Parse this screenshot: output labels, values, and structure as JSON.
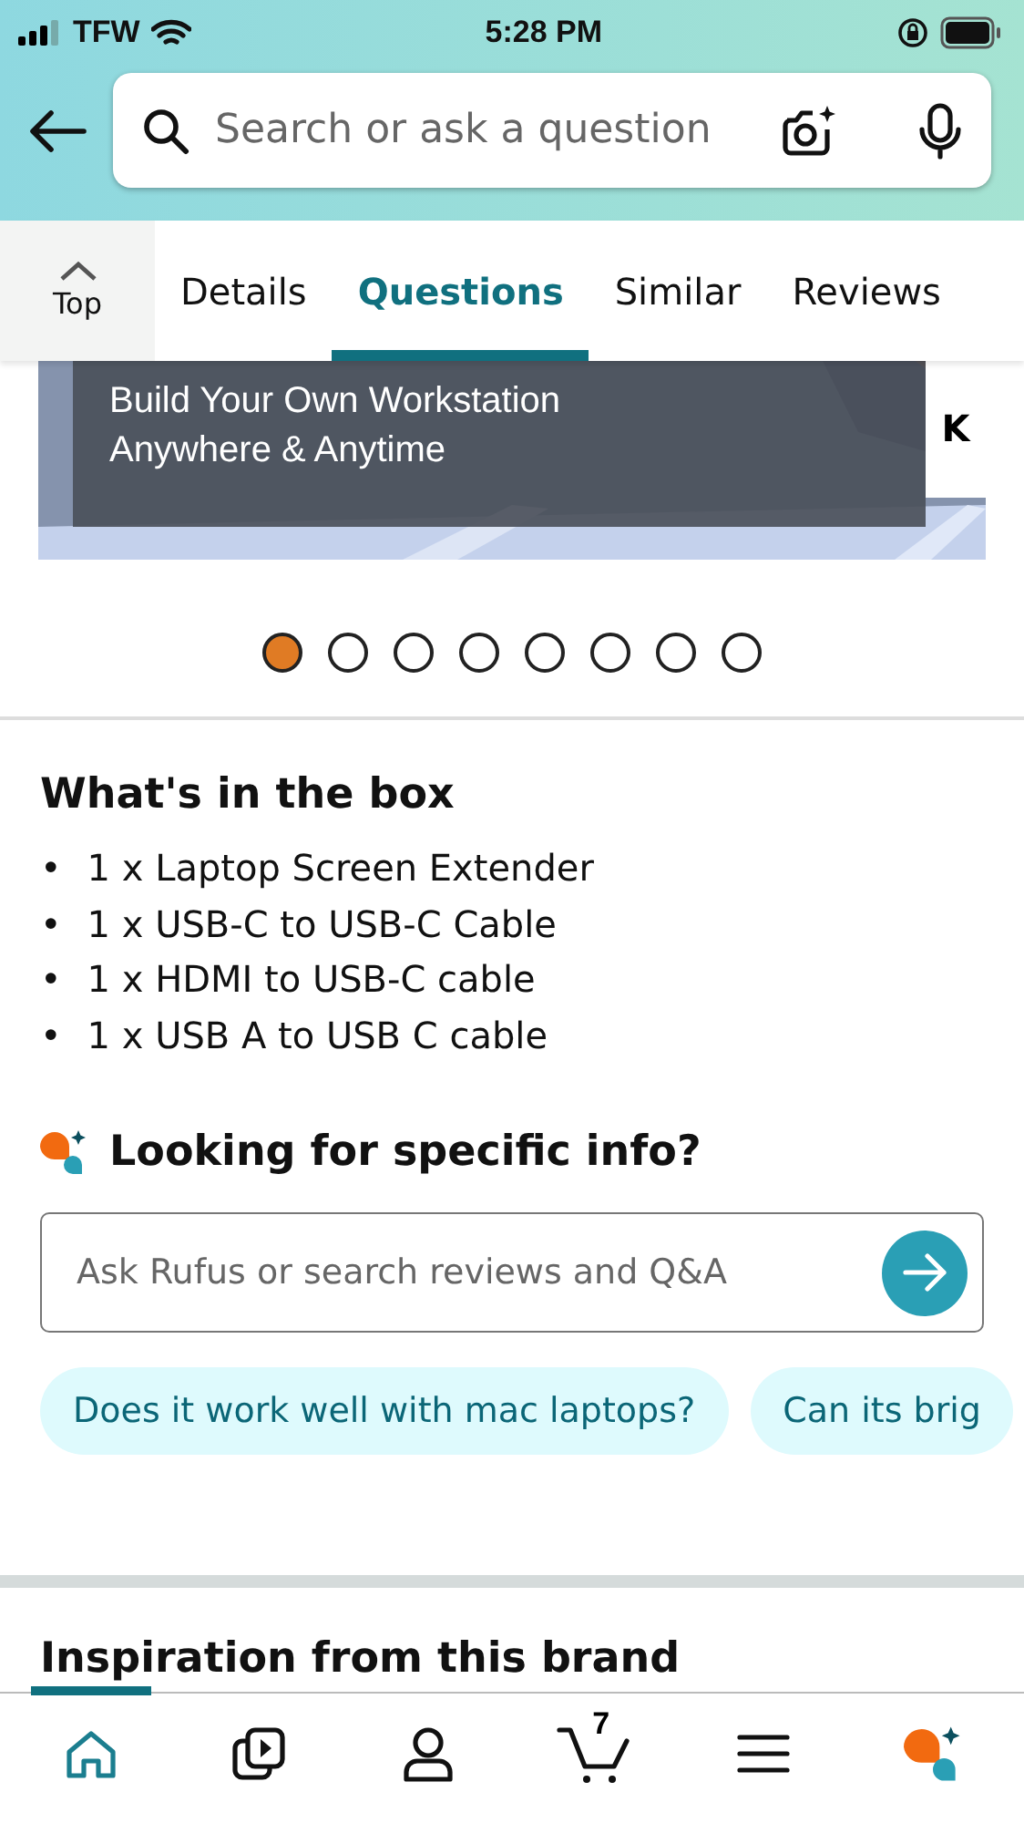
{
  "status_bar": {
    "carrier": "TFW",
    "time": "5:28 PM"
  },
  "search": {
    "placeholder": "Search or ask a question"
  },
  "tabs": [
    {
      "label": "Top",
      "kind": "top",
      "selected": false
    },
    {
      "label": "Details",
      "kind": "tab",
      "selected": false
    },
    {
      "label": "Questions",
      "kind": "tab",
      "selected": true
    },
    {
      "label": "Similar",
      "kind": "tab",
      "selected": false
    },
    {
      "label": "Reviews",
      "kind": "tab",
      "selected": false
    }
  ],
  "banner": {
    "kind": "picture",
    "caption_lines": [
      "Build Your Own Workstation",
      "Anywhere & Anytime"
    ],
    "side_text": "K"
  },
  "carousel_dots": [
    {
      "selected": true
    },
    {
      "selected": false
    },
    {
      "selected": false
    },
    {
      "selected": false
    },
    {
      "selected": false
    },
    {
      "selected": false
    },
    {
      "selected": false
    },
    {
      "selected": false
    }
  ],
  "box_contents": {
    "title": "What's in the box",
    "items": [
      {
        "bullet": "•",
        "text": "1 x Laptop Screen Extender"
      },
      {
        "bullet": "•",
        "text": "1 x USB-C to USB-C Cable"
      },
      {
        "bullet": "•",
        "text": "1 x HDMI to USB-C cable"
      },
      {
        "bullet": "•",
        "text": "1 x USB A to USB C cable"
      }
    ]
  },
  "rufus": {
    "title": "Looking for specific info?",
    "placeholder": "Ask Rufus or search reviews and Q&A",
    "suggestions": [
      "Does it work well with mac laptops?",
      "Can its brig"
    ]
  },
  "next_section": {
    "title": "Inspiration from this brand"
  },
  "bottom_nav": [
    {
      "kind": "home",
      "selected": true
    },
    {
      "kind": "video",
      "selected": false
    },
    {
      "kind": "account",
      "selected": false
    },
    {
      "kind": "cart",
      "selected": false,
      "count": "7"
    },
    {
      "kind": "menu",
      "selected": false
    },
    {
      "kind": "rufus",
      "selected": false
    }
  ]
}
